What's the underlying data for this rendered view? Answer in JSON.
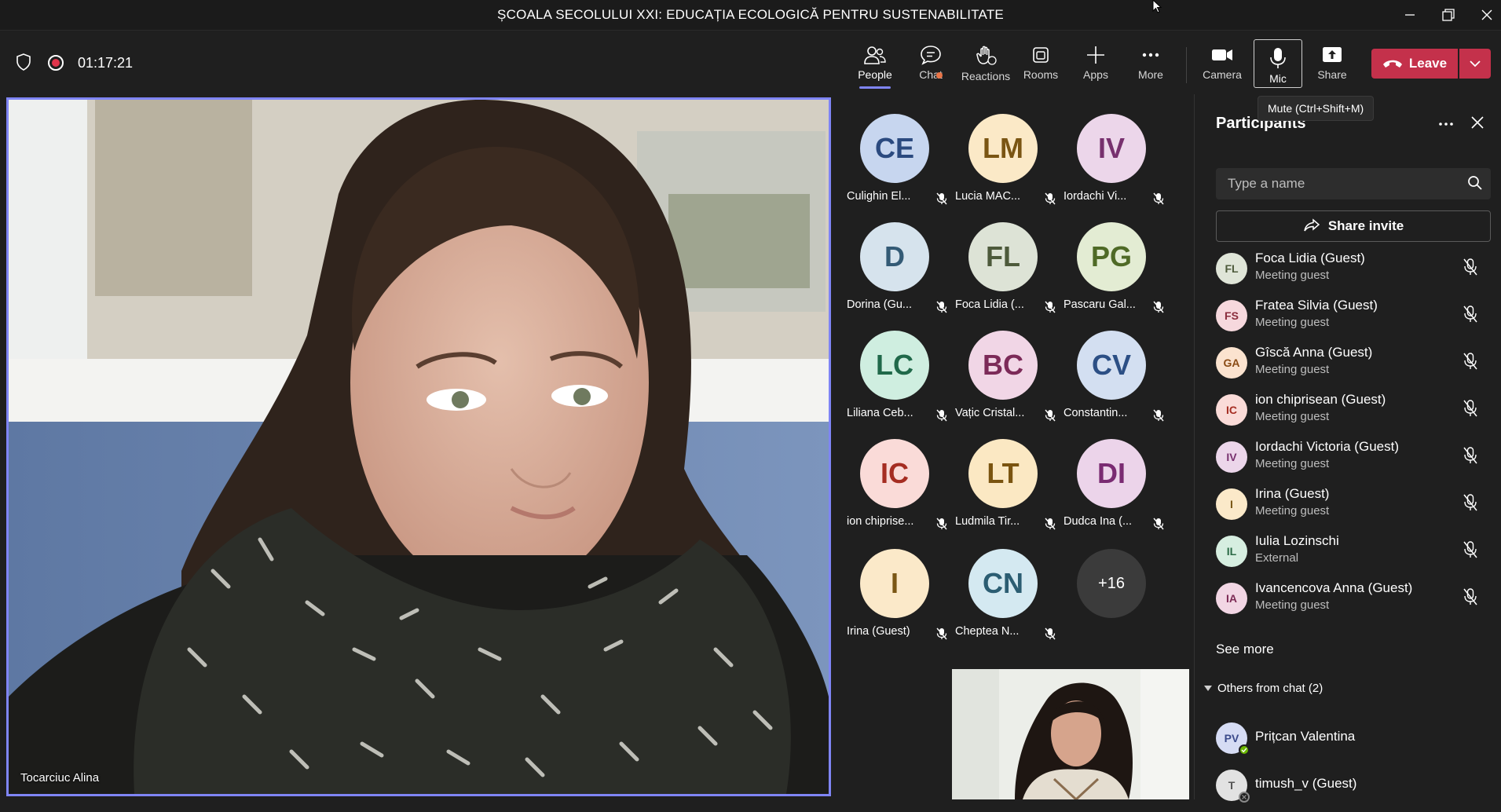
{
  "window": {
    "title": "ȘCOALA SECOLULUI XXI: EDUCAȚIA ECOLOGICĂ PENTRU SUSTENABILITATE",
    "minimize_icon": "minimize-icon",
    "restore_icon": "restore-icon",
    "close_icon": "close-icon"
  },
  "toolbar": {
    "timer": "01:17:21",
    "people": "People",
    "chat": "Chat",
    "reactions": "Reactions",
    "rooms": "Rooms",
    "apps": "Apps",
    "more": "More",
    "camera": "Camera",
    "mic": "Mic",
    "share": "Share",
    "leave": "Leave",
    "leave_color": "#c4314b",
    "accent_color": "#7f85f5"
  },
  "tooltip": {
    "text": "Mute (Ctrl+Shift+M)"
  },
  "main_video": {
    "name": "Tocarciuc Alina"
  },
  "grid": [
    {
      "initials": "CE",
      "name": "Culighin El...",
      "bg": "#c7d6ef",
      "fg": "#2b4a7f"
    },
    {
      "initials": "LM",
      "name": "Lucia MAC...",
      "bg": "#fbe9c7",
      "fg": "#7a5513"
    },
    {
      "initials": "IV",
      "name": "Iordachi Vi...",
      "bg": "#ecd6ea",
      "fg": "#77306e"
    },
    {
      "initials": "D",
      "name": "Dorina (Gu...",
      "bg": "#d6e3ed",
      "fg": "#335a75"
    },
    {
      "initials": "FL",
      "name": "Foca Lidia (...",
      "bg": "#dde3d6",
      "fg": "#4d5a3b"
    },
    {
      "initials": "PG",
      "name": "Pascaru Gal...",
      "bg": "#e3ecd3",
      "fg": "#4f6a26"
    },
    {
      "initials": "LC",
      "name": "Liliana Ceb...",
      "bg": "#cfeee0",
      "fg": "#20694a"
    },
    {
      "initials": "BC",
      "name": "Vațic Cristal...",
      "bg": "#f1d6e6",
      "fg": "#7c2a58"
    },
    {
      "initials": "CV",
      "name": "Constantin...",
      "bg": "#d3dff1",
      "fg": "#2c4f85"
    },
    {
      "initials": "IC",
      "name": "ion chiprise...",
      "bg": "#fadbd8",
      "fg": "#a52d22"
    },
    {
      "initials": "LT",
      "name": "Ludmila Tir...",
      "bg": "#fbe8c3",
      "fg": "#7a5410"
    },
    {
      "initials": "DI",
      "name": "Dudca Ina (...",
      "bg": "#ecd4ea",
      "fg": "#7a2b72"
    },
    {
      "initials": "I",
      "name": "Irina (Guest)",
      "bg": "#fbe9c9",
      "fg": "#7a5715"
    },
    {
      "initials": "CN",
      "name": "Cheptea N...",
      "bg": "#d4e9f1",
      "fg": "#2b5d72"
    }
  ],
  "grid_overflow": "+16",
  "panel": {
    "title": "Participants",
    "search_placeholder": "Type a name",
    "share_invite": "Share invite",
    "participants": [
      {
        "initials": "FL",
        "name": "Foca Lidia (Guest)",
        "role": "Meeting guest",
        "bg": "#dfe5d8",
        "fg": "#4d5a3b"
      },
      {
        "initials": "FS",
        "name": "Fratea Silvia (Guest)",
        "role": "Meeting guest",
        "bg": "#f6d8dd",
        "fg": "#8a2d3d"
      },
      {
        "initials": "GA",
        "name": "Gîscă Anna (Guest)",
        "role": "Meeting guest",
        "bg": "#fbe3cf",
        "fg": "#8a4b14"
      },
      {
        "initials": "IC",
        "name": "ion chiprisean (Guest)",
        "role": "Meeting guest",
        "bg": "#fadbd8",
        "fg": "#a52d22"
      },
      {
        "initials": "IV",
        "name": "Iordachi Victoria (Guest)",
        "role": "Meeting guest",
        "bg": "#ecd6ea",
        "fg": "#77306e"
      },
      {
        "initials": "I",
        "name": "Irina (Guest)",
        "role": "Meeting guest",
        "bg": "#fbe9c9",
        "fg": "#7a5715"
      },
      {
        "initials": "IL",
        "name": "Iulia Lozinschi",
        "role": "External",
        "bg": "#d6eee0",
        "fg": "#2b6a45"
      },
      {
        "initials": "IA",
        "name": "Ivancencova Anna (Guest)",
        "role": "Meeting guest",
        "bg": "#f2d6e4",
        "fg": "#7d2b55"
      }
    ],
    "see_more": "See more",
    "others_label": "Others from chat (2)",
    "others": [
      {
        "initials": "PV",
        "name": "Prițcan Valentina",
        "bg": "#d6dcf4",
        "fg": "#3b4a8a",
        "status": "available"
      },
      {
        "initials": "T",
        "name": "timush_v (Guest)",
        "bg": "#e2e2e2",
        "fg": "#555555",
        "status": "offline"
      }
    ]
  }
}
